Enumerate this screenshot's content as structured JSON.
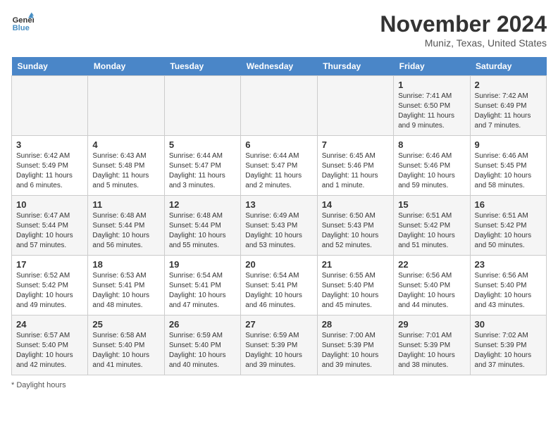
{
  "header": {
    "logo_line1": "General",
    "logo_line2": "Blue",
    "month_title": "November 2024",
    "location": "Muniz, Texas, United States"
  },
  "days_of_week": [
    "Sunday",
    "Monday",
    "Tuesday",
    "Wednesday",
    "Thursday",
    "Friday",
    "Saturday"
  ],
  "footer": {
    "note": "Daylight hours"
  },
  "weeks": [
    {
      "days": [
        {
          "number": "",
          "info": ""
        },
        {
          "number": "",
          "info": ""
        },
        {
          "number": "",
          "info": ""
        },
        {
          "number": "",
          "info": ""
        },
        {
          "number": "",
          "info": ""
        },
        {
          "number": "1",
          "info": "Sunrise: 7:41 AM\nSunset: 6:50 PM\nDaylight: 11 hours and 9 minutes."
        },
        {
          "number": "2",
          "info": "Sunrise: 7:42 AM\nSunset: 6:49 PM\nDaylight: 11 hours and 7 minutes."
        }
      ]
    },
    {
      "days": [
        {
          "number": "3",
          "info": "Sunrise: 6:42 AM\nSunset: 5:49 PM\nDaylight: 11 hours and 6 minutes."
        },
        {
          "number": "4",
          "info": "Sunrise: 6:43 AM\nSunset: 5:48 PM\nDaylight: 11 hours and 5 minutes."
        },
        {
          "number": "5",
          "info": "Sunrise: 6:44 AM\nSunset: 5:47 PM\nDaylight: 11 hours and 3 minutes."
        },
        {
          "number": "6",
          "info": "Sunrise: 6:44 AM\nSunset: 5:47 PM\nDaylight: 11 hours and 2 minutes."
        },
        {
          "number": "7",
          "info": "Sunrise: 6:45 AM\nSunset: 5:46 PM\nDaylight: 11 hours and 1 minute."
        },
        {
          "number": "8",
          "info": "Sunrise: 6:46 AM\nSunset: 5:46 PM\nDaylight: 10 hours and 59 minutes."
        },
        {
          "number": "9",
          "info": "Sunrise: 6:46 AM\nSunset: 5:45 PM\nDaylight: 10 hours and 58 minutes."
        }
      ]
    },
    {
      "days": [
        {
          "number": "10",
          "info": "Sunrise: 6:47 AM\nSunset: 5:44 PM\nDaylight: 10 hours and 57 minutes."
        },
        {
          "number": "11",
          "info": "Sunrise: 6:48 AM\nSunset: 5:44 PM\nDaylight: 10 hours and 56 minutes."
        },
        {
          "number": "12",
          "info": "Sunrise: 6:48 AM\nSunset: 5:44 PM\nDaylight: 10 hours and 55 minutes."
        },
        {
          "number": "13",
          "info": "Sunrise: 6:49 AM\nSunset: 5:43 PM\nDaylight: 10 hours and 53 minutes."
        },
        {
          "number": "14",
          "info": "Sunrise: 6:50 AM\nSunset: 5:43 PM\nDaylight: 10 hours and 52 minutes."
        },
        {
          "number": "15",
          "info": "Sunrise: 6:51 AM\nSunset: 5:42 PM\nDaylight: 10 hours and 51 minutes."
        },
        {
          "number": "16",
          "info": "Sunrise: 6:51 AM\nSunset: 5:42 PM\nDaylight: 10 hours and 50 minutes."
        }
      ]
    },
    {
      "days": [
        {
          "number": "17",
          "info": "Sunrise: 6:52 AM\nSunset: 5:42 PM\nDaylight: 10 hours and 49 minutes."
        },
        {
          "number": "18",
          "info": "Sunrise: 6:53 AM\nSunset: 5:41 PM\nDaylight: 10 hours and 48 minutes."
        },
        {
          "number": "19",
          "info": "Sunrise: 6:54 AM\nSunset: 5:41 PM\nDaylight: 10 hours and 47 minutes."
        },
        {
          "number": "20",
          "info": "Sunrise: 6:54 AM\nSunset: 5:41 PM\nDaylight: 10 hours and 46 minutes."
        },
        {
          "number": "21",
          "info": "Sunrise: 6:55 AM\nSunset: 5:40 PM\nDaylight: 10 hours and 45 minutes."
        },
        {
          "number": "22",
          "info": "Sunrise: 6:56 AM\nSunset: 5:40 PM\nDaylight: 10 hours and 44 minutes."
        },
        {
          "number": "23",
          "info": "Sunrise: 6:56 AM\nSunset: 5:40 PM\nDaylight: 10 hours and 43 minutes."
        }
      ]
    },
    {
      "days": [
        {
          "number": "24",
          "info": "Sunrise: 6:57 AM\nSunset: 5:40 PM\nDaylight: 10 hours and 42 minutes."
        },
        {
          "number": "25",
          "info": "Sunrise: 6:58 AM\nSunset: 5:40 PM\nDaylight: 10 hours and 41 minutes."
        },
        {
          "number": "26",
          "info": "Sunrise: 6:59 AM\nSunset: 5:40 PM\nDaylight: 10 hours and 40 minutes."
        },
        {
          "number": "27",
          "info": "Sunrise: 6:59 AM\nSunset: 5:39 PM\nDaylight: 10 hours and 39 minutes."
        },
        {
          "number": "28",
          "info": "Sunrise: 7:00 AM\nSunset: 5:39 PM\nDaylight: 10 hours and 39 minutes."
        },
        {
          "number": "29",
          "info": "Sunrise: 7:01 AM\nSunset: 5:39 PM\nDaylight: 10 hours and 38 minutes."
        },
        {
          "number": "30",
          "info": "Sunrise: 7:02 AM\nSunset: 5:39 PM\nDaylight: 10 hours and 37 minutes."
        }
      ]
    }
  ]
}
